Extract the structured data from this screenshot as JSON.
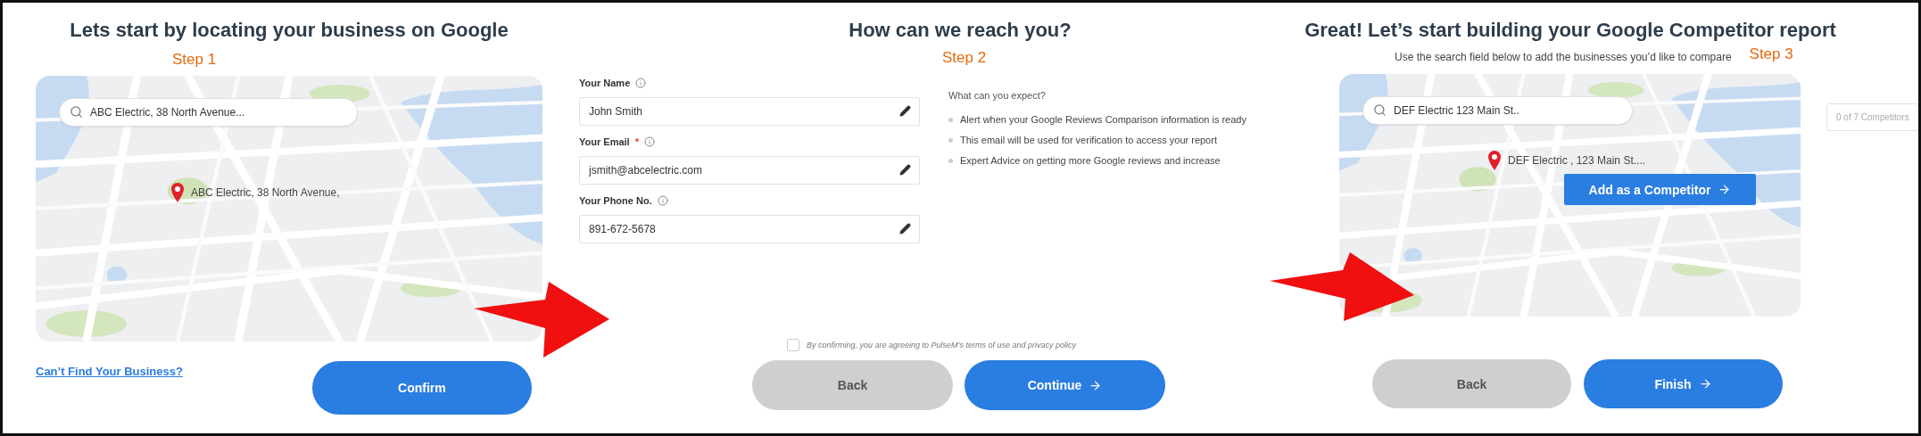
{
  "step1": {
    "title": "Lets start by locating your business on Google",
    "step": "Step 1",
    "search": {
      "value": "ABC Electric, 38 North Avenue..."
    },
    "pin_label": "ABC Electric, 38 North Avenue,",
    "link": "Can’t Find Your Business?",
    "buttons": [
      {
        "label": "Confirm",
        "kind": "primary",
        "arrow": false
      }
    ]
  },
  "step2": {
    "title": "How can we reach you?",
    "step": "Step 2",
    "fields": [
      {
        "label": "Your Name",
        "value": "John Smith"
      },
      {
        "label": "Your Email",
        "marker": "*",
        "value": "jsmith@abcelectric.com"
      },
      {
        "label": "Your Phone No.",
        "value": "891-672-5678"
      }
    ],
    "expect": {
      "heading": "What can you expect?",
      "items": [
        "Alert when your Google Reviews Comparison information is ready",
        "This email will be used for verification to access your report",
        "Expert Advice on getting more Google reviews and increase"
      ]
    },
    "consent": {
      "text": "By confirming, you are agreeing to PulseM’s terms of use and privacy policy",
      "checked": false
    },
    "buttons": [
      {
        "label": "Back",
        "kind": "secondary",
        "arrow": false
      },
      {
        "label": "Continue",
        "kind": "primary",
        "arrow": true
      }
    ]
  },
  "step3": {
    "title": "Great! Let’s start building your Google Competitor report",
    "subtitle": "Use the search field below to add the businesses you’d like to compare",
    "step": "Step 3",
    "search": {
      "value": "DEF Electric 123 Main St.."
    },
    "pin_label": "DEF Electric , 123 Main St....",
    "add_button": "Add as a Competitor",
    "counter": "0 of 7 Competitors",
    "buttons": [
      {
        "label": "Back",
        "kind": "secondary",
        "arrow": false
      },
      {
        "label": "Finish",
        "kind": "primary",
        "arrow": true
      }
    ]
  }
}
